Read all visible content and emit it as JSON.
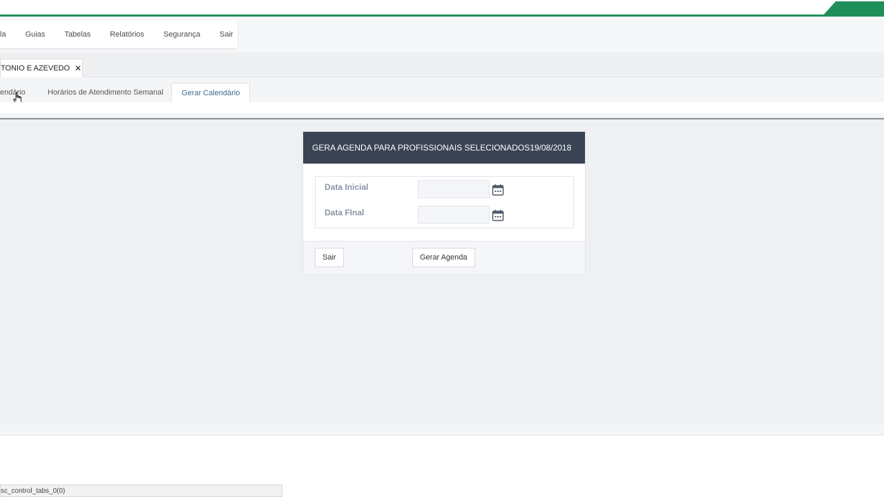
{
  "menu": {
    "items": [
      "la",
      "Guias",
      "Tabelas",
      "Relatórios",
      "Segurança",
      "Sair"
    ]
  },
  "doc_tab": {
    "label": "TONIO E AZEVEDO",
    "close": "✕"
  },
  "sub_tabs": [
    {
      "label": "endário"
    },
    {
      "label": "Horários de Atendimento Semanal"
    },
    {
      "label": "Gerar Calendário",
      "active": true
    }
  ],
  "form": {
    "title": "GERA AGENDA PARA PROFISSIONAIS SELECIONADOS19/08/2018",
    "data_inicial_label": "Data Inicial",
    "data_inicial_value": "",
    "data_final_label": "Data FInal",
    "data_final_value": "",
    "sair_label": "Sair",
    "gerar_label": "Gerar Agenda"
  },
  "status": {
    "text": "sc_control_tabs_0(0)"
  },
  "colors": {
    "brand_green": "#1f8f5a",
    "header_bg": "#3a4455",
    "active_tab_text": "#3b6a8c"
  },
  "icons": {
    "calendar": "calendar-icon",
    "close": "close-icon",
    "cursor": "hand-pointer-icon"
  }
}
